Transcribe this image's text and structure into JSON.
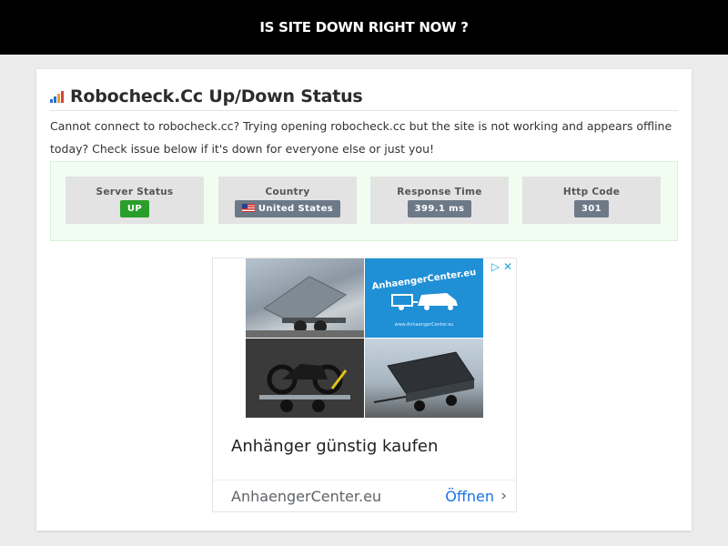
{
  "header": {
    "title": "IS SITE DOWN RIGHT NOW ?"
  },
  "card": {
    "title": "Robocheck.Cc Up/Down Status",
    "description": "Cannot connect to robocheck.cc? Trying opening robocheck.cc but the site is not working and appears offline today? Check issue below if it's down for everyone else or just you!"
  },
  "status": [
    {
      "label": "Server Status",
      "value": "UP",
      "color": "#2a9e2a"
    },
    {
      "label": "Country",
      "value": "United States",
      "color": "#6c7a88"
    },
    {
      "label": "Response Time",
      "value": "399.1 ms",
      "color": "#6c7a88"
    },
    {
      "label": "Http Code",
      "value": "301",
      "color": "#6c7a88"
    }
  ],
  "ad": {
    "image_brand": "AnhaengerCenter.eu",
    "image_sub": "www.AnhaengerCenter.eu",
    "headline": "Anhänger günstig kaufen",
    "domain": "AnhaengerCenter.eu",
    "cta": "Öffnen",
    "icons": [
      "adchoices-play-icon",
      "close-icon",
      "chevron-right-icon"
    ]
  }
}
